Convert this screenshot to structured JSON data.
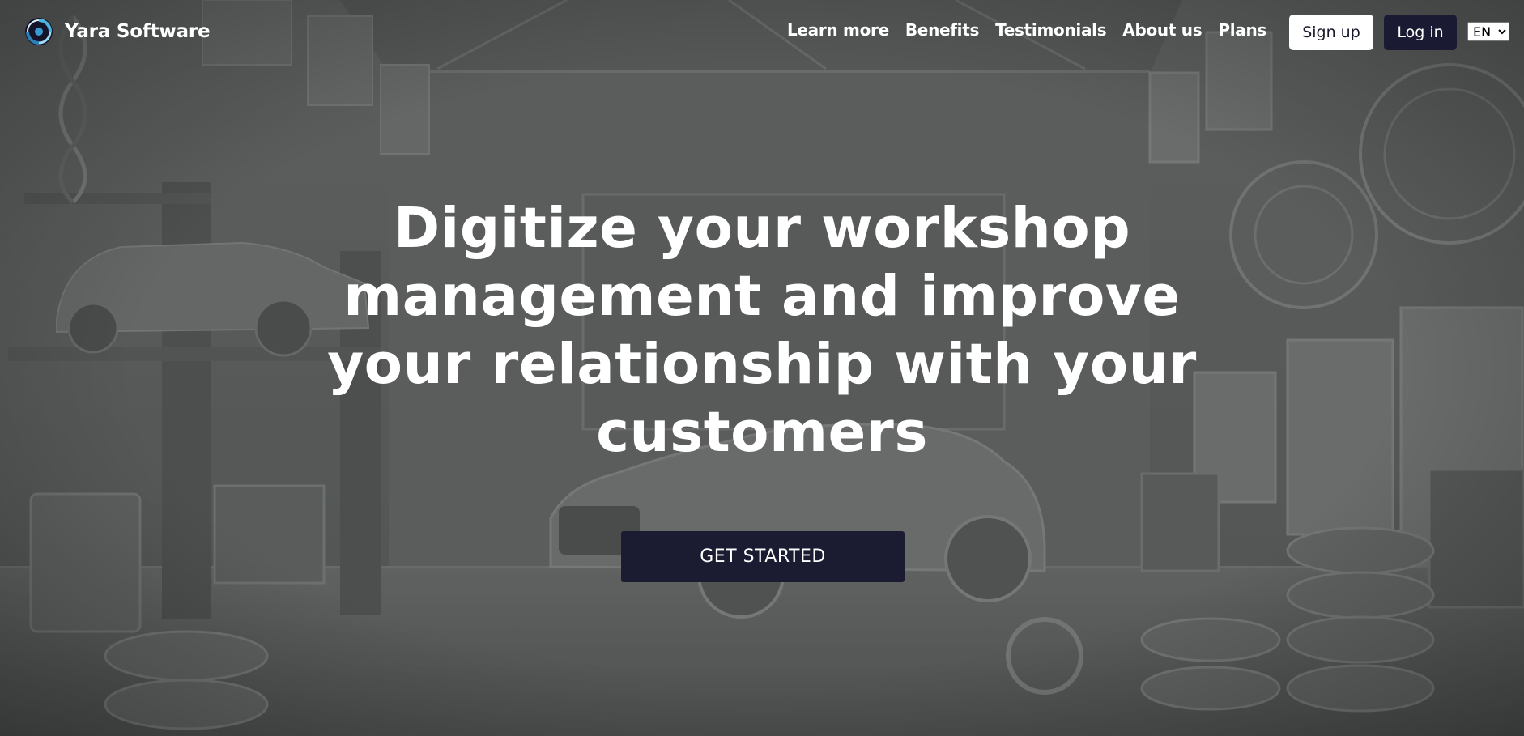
{
  "brand": {
    "name": "Yara Software",
    "logo_icon": "yara-swirl-logo-icon"
  },
  "nav": {
    "links": [
      {
        "label": "Learn more"
      },
      {
        "label": "Benefits"
      },
      {
        "label": "Testimonials"
      },
      {
        "label": "About us"
      },
      {
        "label": "Plans"
      }
    ],
    "signup_label": "Sign up",
    "login_label": "Log in",
    "language": {
      "selected": "EN"
    }
  },
  "hero": {
    "title": "Digitize your workshop management and improve your relationship with your customers",
    "cta_label": "GET STARTED"
  },
  "colors": {
    "primary_dark": "#1a1b33",
    "text_light": "#ffffff",
    "background_overlay": "#5b5d5c"
  }
}
